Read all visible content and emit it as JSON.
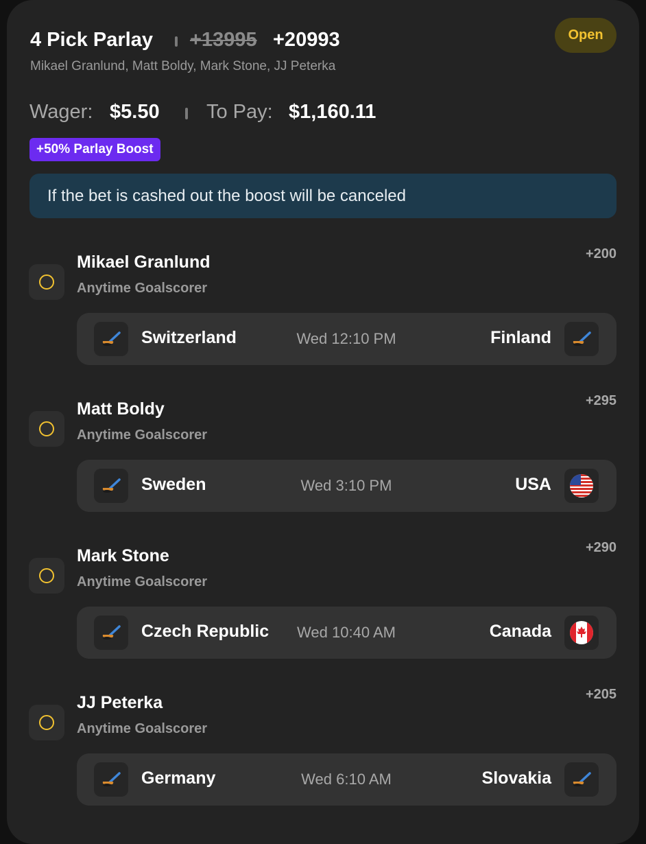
{
  "header": {
    "title": "4 Pick Parlay",
    "odds_original": "+13995",
    "odds_boosted": "+20993",
    "players_summary": "Mikael Granlund, Matt Boldy, Mark Stone, JJ Peterka",
    "status": "Open"
  },
  "wager": {
    "wager_label": "Wager:",
    "wager_value": "$5.50",
    "pay_label": "To Pay:",
    "pay_value": "$1,160.11"
  },
  "boost": {
    "label": "+50% Parlay Boost",
    "notice": "If the bet is cashed out the boost will be canceled"
  },
  "picks": [
    {
      "player": "Mikael Granlund",
      "market": "Anytime Goalscorer",
      "odds": "+200",
      "home_team": "Switzerland",
      "home_icon": "hockey-stick-icon",
      "time": "Wed 12:10 PM",
      "away_team": "Finland",
      "away_icon": "hockey-stick-icon"
    },
    {
      "player": "Matt Boldy",
      "market": "Anytime Goalscorer",
      "odds": "+295",
      "home_team": "Sweden",
      "home_icon": "hockey-stick-icon",
      "time": "Wed 3:10 PM",
      "away_team": "USA",
      "away_icon": "usa-flag-icon"
    },
    {
      "player": "Mark Stone",
      "market": "Anytime Goalscorer",
      "odds": "+290",
      "home_team": "Czech Republic",
      "home_icon": "hockey-stick-icon",
      "time": "Wed 10:40 AM",
      "away_team": "Canada",
      "away_icon": "canada-flag-icon"
    },
    {
      "player": "JJ Peterka",
      "market": "Anytime Goalscorer",
      "odds": "+205",
      "home_team": "Germany",
      "home_icon": "hockey-stick-icon",
      "time": "Wed 6:10 AM",
      "away_team": "Slovakia",
      "away_icon": "hockey-stick-icon"
    }
  ],
  "colors": {
    "card_background": "#232323",
    "accent_yellow": "#f2c230",
    "boost_purple": "#6c2bf0",
    "notice_background": "#1d3a4c"
  }
}
